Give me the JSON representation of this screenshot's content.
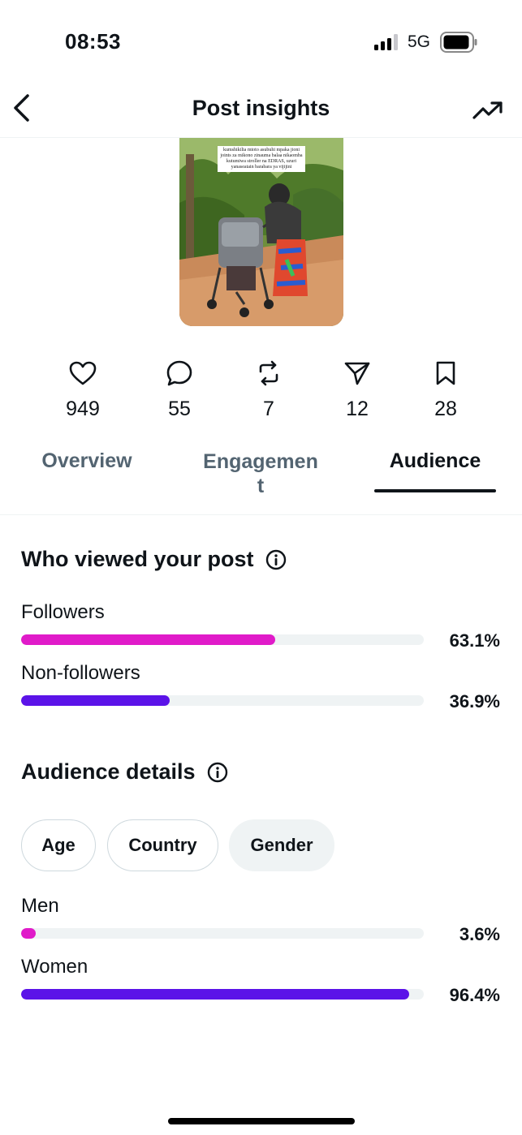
{
  "status_bar": {
    "time": "08:53",
    "network": "5G",
    "icons": [
      "signal-icon",
      "battery-icon"
    ]
  },
  "header": {
    "title": "Post insights",
    "back_icon": "chevron-left-icon",
    "trend_icon": "trending-up-icon"
  },
  "post": {
    "caption": "kumshikilia mtoto asubuhi mpaka jioni joints za mikono zinauma balaa nikaomba kutumiwa stroller na EDRAS, uzuri yanaseatain barabara ya vijijini"
  },
  "stats": [
    {
      "icon": "heart-icon",
      "value": "949"
    },
    {
      "icon": "reply-icon",
      "value": "55"
    },
    {
      "icon": "repost-icon",
      "value": "7"
    },
    {
      "icon": "share-icon",
      "value": "12"
    },
    {
      "icon": "bookmark-icon",
      "value": "28"
    }
  ],
  "tabs": [
    {
      "label": "Overview",
      "active": false
    },
    {
      "label": "Engagemen\nt",
      "active": false
    },
    {
      "label": "Audience",
      "active": true
    }
  ],
  "who_viewed": {
    "title": "Who viewed your post",
    "rows": [
      {
        "label": "Followers",
        "percent_text": "63.1%",
        "value": 63.1,
        "color": "#e01bc9"
      },
      {
        "label": "Non-followers",
        "percent_text": "36.9%",
        "value": 36.9,
        "color": "#5b13e8"
      }
    ]
  },
  "audience_details": {
    "title": "Audience details",
    "chips": [
      {
        "label": "Age",
        "selected": false
      },
      {
        "label": "Country",
        "selected": false
      },
      {
        "label": "Gender",
        "selected": true
      }
    ],
    "rows": [
      {
        "label": "Men",
        "percent_text": "3.6%",
        "value": 3.6,
        "color": "#e01bc9"
      },
      {
        "label": "Women",
        "percent_text": "96.4%",
        "value": 96.4,
        "color": "#5b13e8"
      }
    ]
  }
}
